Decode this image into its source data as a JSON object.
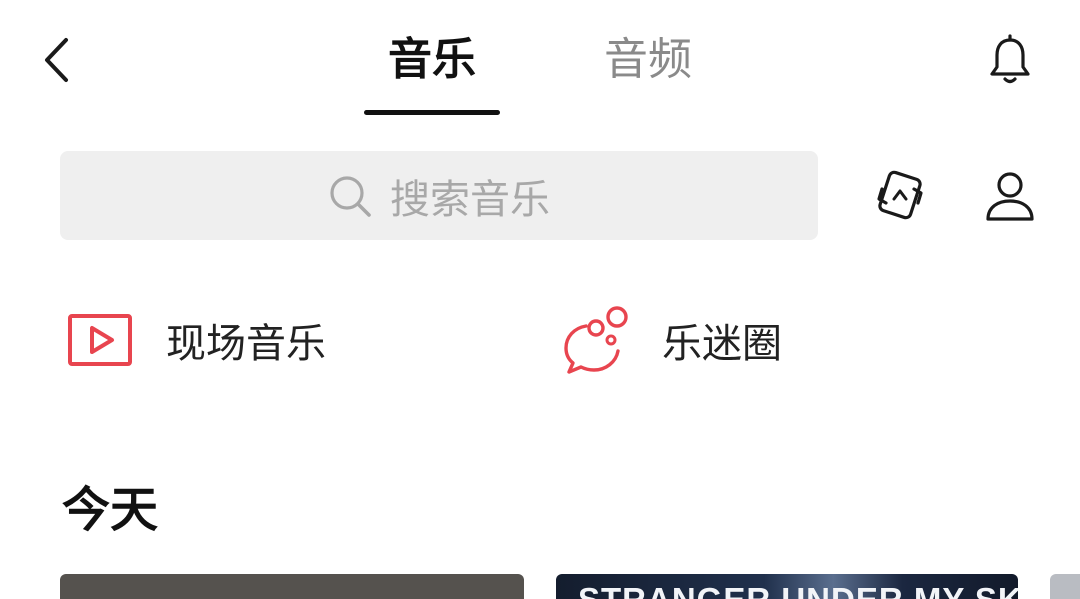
{
  "header": {
    "tabs": [
      {
        "label": "音乐",
        "active": true
      },
      {
        "label": "音频",
        "active": false
      }
    ],
    "back_icon": "chevron-left-icon",
    "notification_icon": "bell-icon"
  },
  "search": {
    "placeholder": "搜索音乐",
    "search_icon": "search-icon",
    "scan_icon": "recognize-music-icon",
    "profile_icon": "user-icon"
  },
  "shortcuts": [
    {
      "label": "现场音乐",
      "icon": "play-video-icon"
    },
    {
      "label": "乐迷圈",
      "icon": "chat-bubbles-icon"
    }
  ],
  "today": {
    "title": "今天",
    "cards": [
      {
        "title": ""
      },
      {
        "title": "STRANGER UNDER MY SKIN"
      },
      {
        "title": ""
      }
    ]
  },
  "colors": {
    "accent": "#e8454f",
    "text_primary": "#111111",
    "text_secondary": "#8a8a8a",
    "search_bg": "#efefef"
  }
}
